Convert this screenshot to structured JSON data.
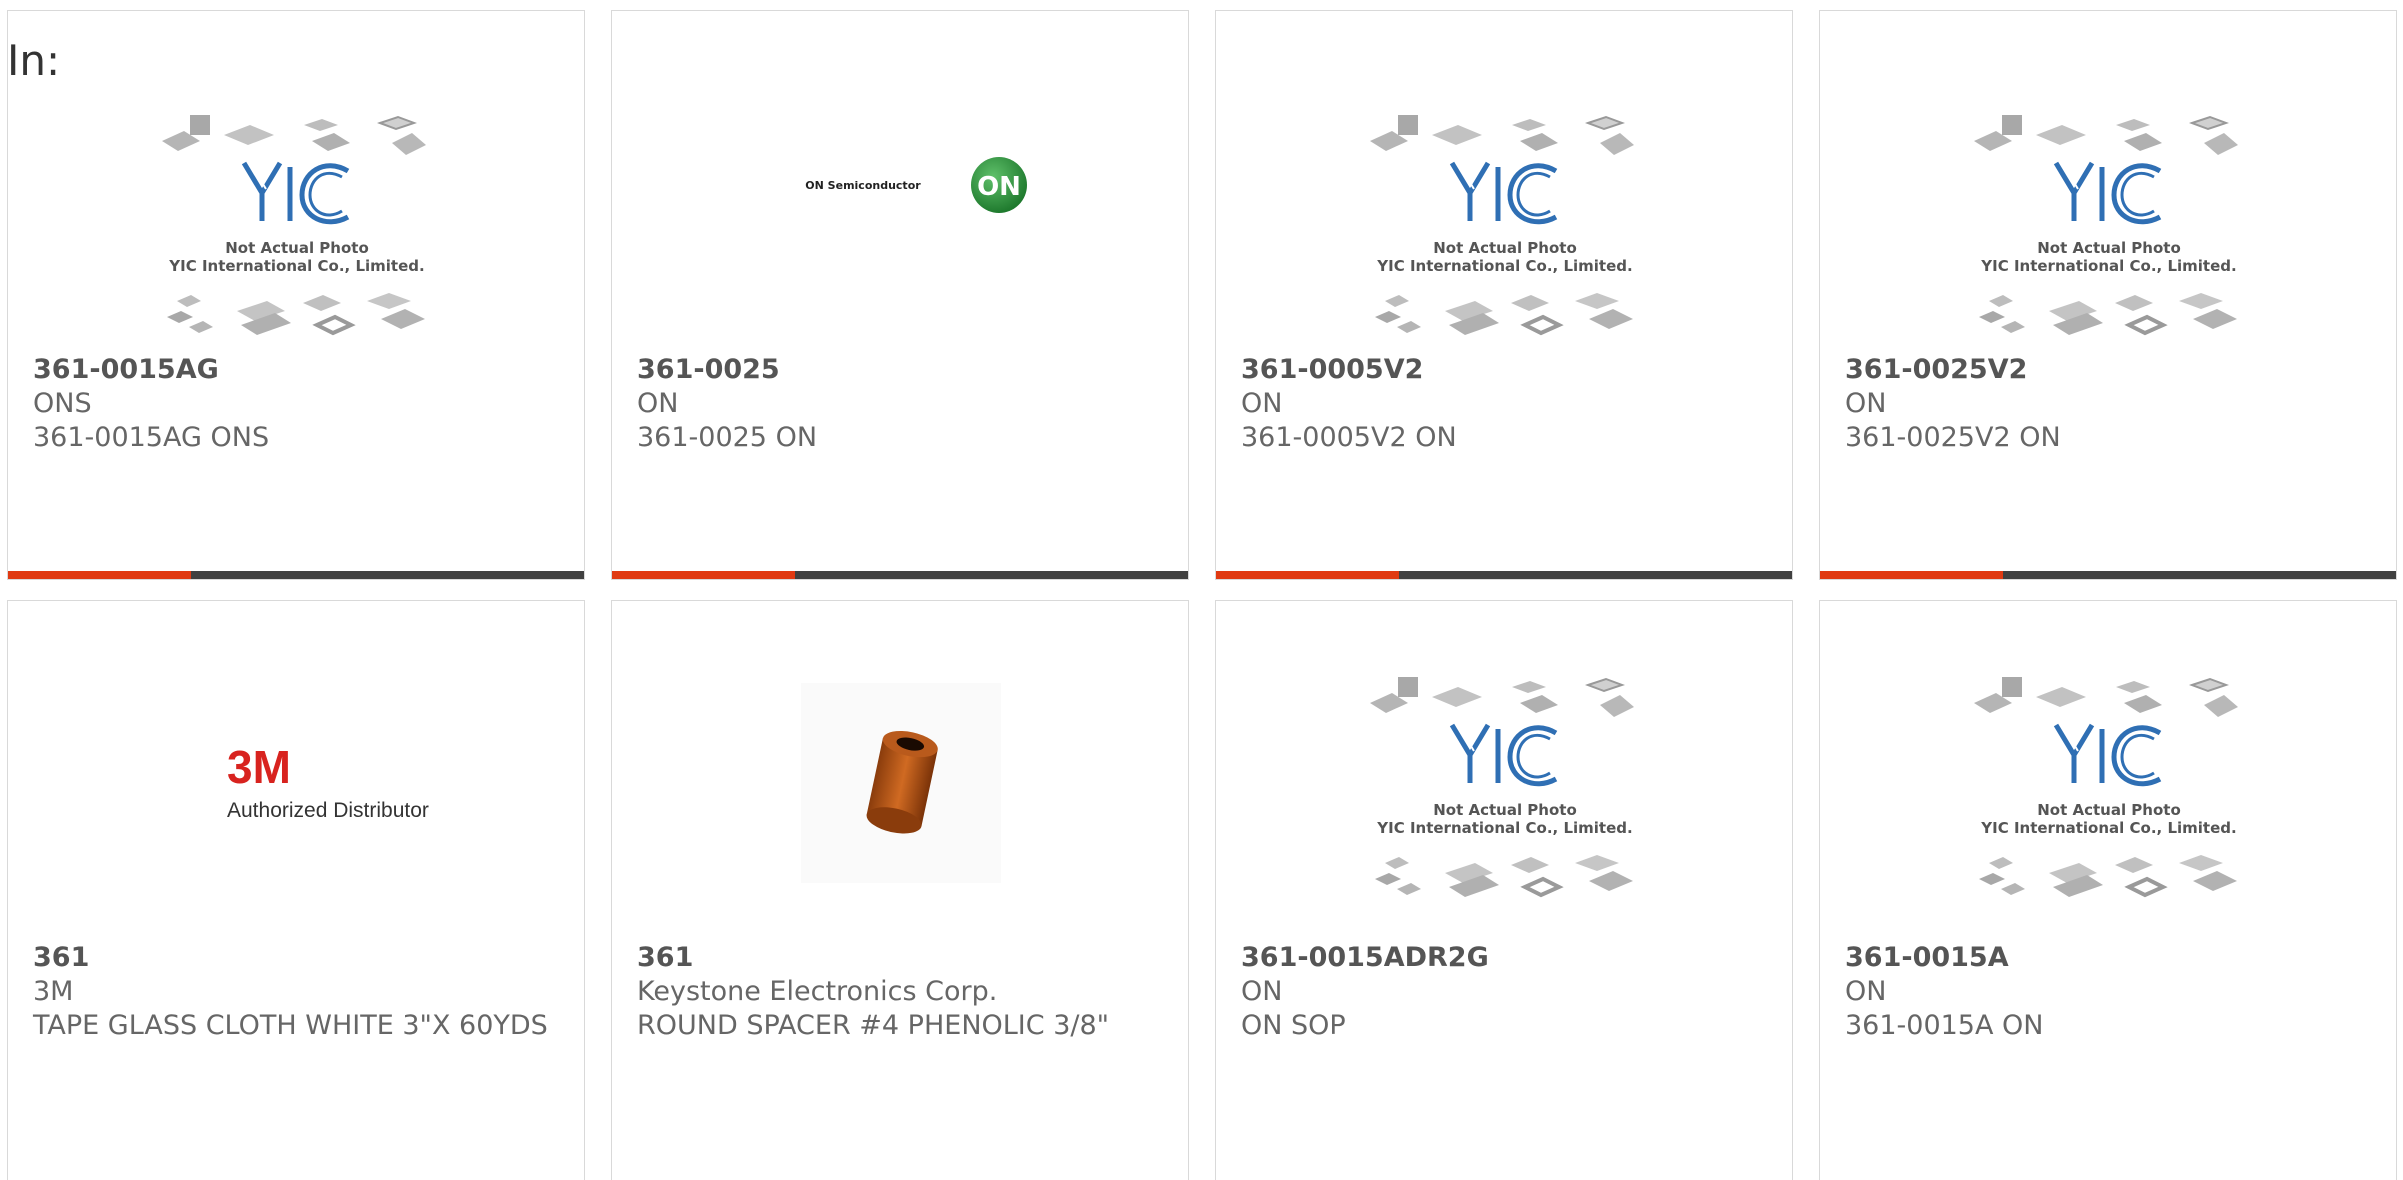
{
  "filter_label": "In:",
  "colors": {
    "accent": "#e03a12",
    "bar": "#404040",
    "yic_blue": "#2f6fb4",
    "on_green": "#2e8b3d",
    "brand_red": "#d8231f"
  },
  "placeholder": {
    "line1": "Not Actual Photo",
    "line2": "YIC International Co., Limited.",
    "logo": "YIC"
  },
  "on_logo": {
    "wordmark": "ON Semiconductor",
    "badge": "ON"
  },
  "threem_logo": {
    "mark": "3M",
    "tagline": "Authorized Distributor"
  },
  "products": [
    {
      "part": "361-0015AG",
      "mfr": "ONS",
      "desc": "361-0015AG ONS",
      "image": "yic-placeholder"
    },
    {
      "part": "361-0025",
      "mfr": "ON",
      "desc": "361-0025 ON",
      "image": "on-semiconductor-logo"
    },
    {
      "part": "361-0005V2",
      "mfr": "ON",
      "desc": "361-0005V2 ON",
      "image": "yic-placeholder"
    },
    {
      "part": "361-0025V2",
      "mfr": "ON",
      "desc": "361-0025V2 ON",
      "image": "yic-placeholder"
    },
    {
      "part": "361",
      "mfr": "3M",
      "desc": "TAPE GLASS CLOTH WHITE 3\"X 60YDS",
      "image": "3m-logo"
    },
    {
      "part": "361",
      "mfr": "Keystone Electronics Corp.",
      "desc": "ROUND SPACER #4 PHENOLIC 3/8\"",
      "image": "spacer-photo"
    },
    {
      "part": "361-0015ADR2G",
      "mfr": "ON",
      "desc": "ON SOP",
      "image": "yic-placeholder"
    },
    {
      "part": "361-0015A",
      "mfr": "ON",
      "desc": "361-0015A ON",
      "image": "yic-placeholder"
    }
  ]
}
